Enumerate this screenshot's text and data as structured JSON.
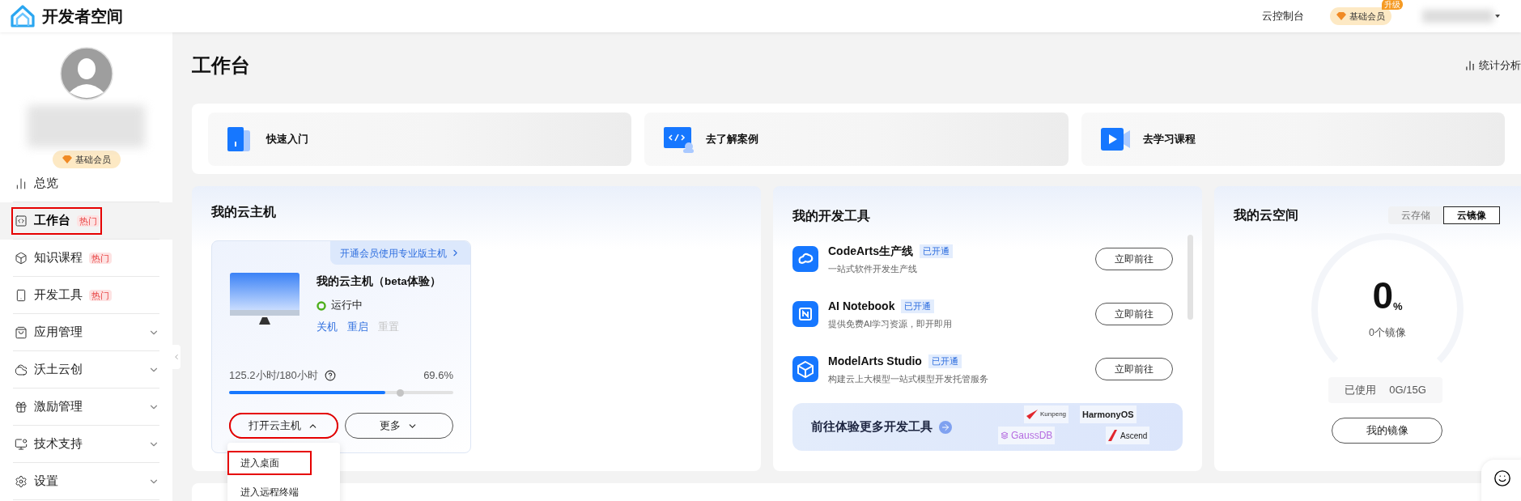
{
  "header": {
    "brand": "开发者空间",
    "links": [
      "云控制台"
    ],
    "member": {
      "label": "基础会员",
      "badge": "升级"
    }
  },
  "sidebar": {
    "member_badge": "基础会员",
    "items": [
      {
        "label": "总览",
        "selected": false,
        "expandable": false
      },
      {
        "label": "工作台",
        "selected": true,
        "badge": "热门",
        "expandable": false
      },
      {
        "label": "知识课程",
        "selected": false,
        "badge": "热门",
        "expandable": false
      },
      {
        "label": "开发工具",
        "selected": false,
        "badge": "热门",
        "expandable": false
      },
      {
        "label": "应用管理",
        "selected": false,
        "expandable": true
      },
      {
        "label": "沃土云创",
        "selected": false,
        "expandable": true
      },
      {
        "label": "激励管理",
        "selected": false,
        "expandable": true
      },
      {
        "label": "技术支持",
        "selected": false,
        "expandable": true
      },
      {
        "label": "设置",
        "selected": false,
        "expandable": true
      }
    ]
  },
  "page": {
    "title": "工作台",
    "stats_link": "统计分析"
  },
  "shortcuts": [
    {
      "label": "快速入门"
    },
    {
      "label": "去了解案例"
    },
    {
      "label": "去学习课程"
    }
  ],
  "cloud_host": {
    "title": "我的云主机",
    "promo": "开通会员使用专业版主机",
    "name": "我的云主机（beta体验）",
    "status": "运行中",
    "actions": [
      {
        "label": "关机",
        "disabled": false
      },
      {
        "label": "重启",
        "disabled": false
      },
      {
        "label": "重置",
        "disabled": true
      }
    ],
    "usage": "125.2小时/180小时",
    "percent": "69.6%",
    "level": 0.696,
    "buttons": [
      {
        "label": "打开云主机",
        "expanded": true
      },
      {
        "label": "更多",
        "expanded": false
      }
    ],
    "menu": [
      {
        "label": "进入桌面",
        "selected": true
      },
      {
        "label": "进入远程终端",
        "selected": false
      }
    ]
  },
  "dev_tools": {
    "title": "我的开发工具",
    "items": [
      {
        "name": "CodeArts生产线",
        "tag": "已开通",
        "desc": "一站式软件开发生产线",
        "button": "立即前往"
      },
      {
        "name": "AI Notebook",
        "tag": "已开通",
        "desc": "提供免费AI学习资源，即开即用",
        "button": "立即前往"
      },
      {
        "name": "ModelArts Studio",
        "tag": "已开通",
        "desc": "构建云上大模型一站式模型开发托管服务",
        "button": "立即前往"
      }
    ],
    "banner": "前往体验更多开发工具",
    "logos": [
      "Kunpeng",
      "HarmonyOS",
      "GaussDB",
      "Ascend"
    ]
  },
  "cloud_space": {
    "title": "我的云空间",
    "tabs": [
      {
        "label": "云存储",
        "selected": false
      },
      {
        "label": "云镜像",
        "selected": true
      }
    ],
    "value": "0",
    "unit": "%",
    "caption": "0个镜像",
    "used_label": "已使用",
    "used_value": "0G/15G",
    "button": "我的镜像"
  }
}
